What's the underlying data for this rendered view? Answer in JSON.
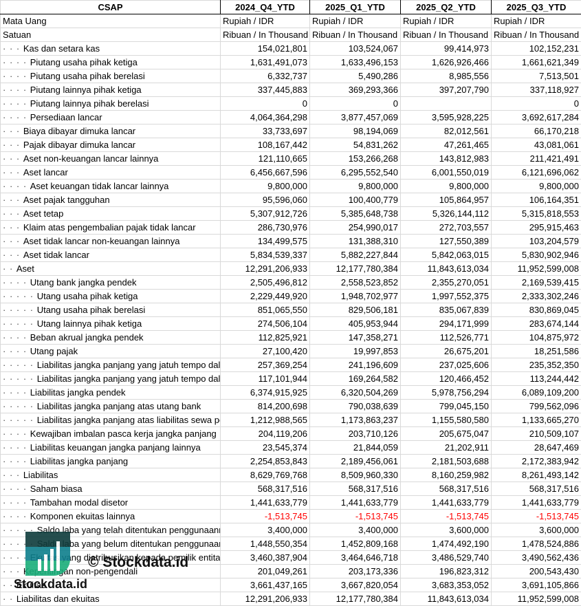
{
  "header": {
    "title": "CSAP",
    "columns": [
      "2024_Q4_YTD",
      "2025_Q1_YTD",
      "2025_Q2_YTD",
      "2025_Q3_YTD"
    ]
  },
  "meta_rows": [
    {
      "label": "Mata Uang",
      "values": [
        "Rupiah / IDR",
        "Rupiah / IDR",
        "Rupiah / IDR",
        "Rupiah / IDR"
      ]
    },
    {
      "label": "Satuan",
      "values": [
        "Ribuan / In Thousand",
        "Ribuan / In Thousand",
        "Ribuan / In Thousand",
        "Ribuan / In Thousand"
      ]
    }
  ],
  "rows": [
    {
      "level": 3,
      "label": "Kas dan setara kas",
      "values": [
        "154,021,801",
        "103,524,067",
        "99,414,973",
        "102,152,231"
      ]
    },
    {
      "level": 4,
      "label": "Piutang usaha pihak ketiga",
      "values": [
        "1,631,491,073",
        "1,633,496,153",
        "1,626,926,466",
        "1,661,621,349"
      ]
    },
    {
      "level": 4,
      "label": "Piutang usaha pihak berelasi",
      "values": [
        "6,332,737",
        "5,490,286",
        "8,985,556",
        "7,513,501"
      ]
    },
    {
      "level": 4,
      "label": "Piutang lainnya pihak ketiga",
      "values": [
        "337,445,883",
        "369,293,366",
        "397,207,790",
        "337,118,927"
      ]
    },
    {
      "level": 4,
      "label": "Piutang lainnya pihak berelasi",
      "values": [
        "0",
        "0",
        "",
        "0"
      ]
    },
    {
      "level": 4,
      "label": "Persediaan lancar",
      "values": [
        "4,064,364,298",
        "3,877,457,069",
        "3,595,928,225",
        "3,692,617,284"
      ]
    },
    {
      "level": 3,
      "label": "Biaya dibayar dimuka lancar",
      "values": [
        "33,733,697",
        "98,194,069",
        "82,012,561",
        "66,170,218"
      ]
    },
    {
      "level": 3,
      "label": "Pajak dibayar dimuka lancar",
      "values": [
        "108,167,442",
        "54,831,262",
        "47,261,465",
        "43,081,061"
      ]
    },
    {
      "level": 3,
      "label": "Aset non-keuangan lancar lainnya",
      "values": [
        "121,110,665",
        "153,266,268",
        "143,812,983",
        "211,421,491"
      ]
    },
    {
      "level": 3,
      "label": "Aset lancar",
      "values": [
        "6,456,667,596",
        "6,295,552,540",
        "6,001,550,019",
        "6,121,696,062"
      ]
    },
    {
      "level": 4,
      "label": "Aset keuangan tidak lancar lainnya",
      "values": [
        "9,800,000",
        "9,800,000",
        "9,800,000",
        "9,800,000"
      ]
    },
    {
      "level": 3,
      "label": "Aset pajak tangguhan",
      "values": [
        "95,596,060",
        "100,400,779",
        "105,864,957",
        "106,164,351"
      ]
    },
    {
      "level": 3,
      "label": "Aset tetap",
      "values": [
        "5,307,912,726",
        "5,385,648,738",
        "5,326,144,112",
        "5,315,818,553"
      ]
    },
    {
      "level": 3,
      "label": "Klaim atas pengembalian pajak tidak lancar",
      "values": [
        "286,730,976",
        "254,990,017",
        "272,703,557",
        "295,915,463"
      ]
    },
    {
      "level": 3,
      "label": "Aset tidak lancar non-keuangan lainnya",
      "values": [
        "134,499,575",
        "131,388,310",
        "127,550,389",
        "103,204,579"
      ]
    },
    {
      "level": 3,
      "label": "Aset tidak lancar",
      "values": [
        "5,834,539,337",
        "5,882,227,844",
        "5,842,063,015",
        "5,830,902,946"
      ]
    },
    {
      "level": 2,
      "label": "Aset",
      "values": [
        "12,291,206,933",
        "12,177,780,384",
        "11,843,613,034",
        "11,952,599,008"
      ]
    },
    {
      "level": 4,
      "label": "Utang bank jangka pendek",
      "values": [
        "2,505,496,812",
        "2,558,523,852",
        "2,355,270,051",
        "2,169,539,415"
      ]
    },
    {
      "level": 5,
      "label": "Utang usaha pihak ketiga",
      "values": [
        "2,229,449,920",
        "1,948,702,977",
        "1,997,552,375",
        "2,333,302,246"
      ]
    },
    {
      "level": 5,
      "label": "Utang usaha pihak berelasi",
      "values": [
        "851,065,550",
        "829,506,181",
        "835,067,839",
        "830,869,045"
      ]
    },
    {
      "level": 5,
      "label": "Utang lainnya pihak ketiga",
      "values": [
        "274,506,104",
        "405,953,944",
        "294,171,999",
        "283,674,144"
      ]
    },
    {
      "level": 4,
      "label": "Beban akrual jangka pendek",
      "values": [
        "112,825,921",
        "147,358,271",
        "112,526,771",
        "104,875,972"
      ]
    },
    {
      "level": 4,
      "label": "Utang pajak",
      "values": [
        "27,100,420",
        "19,997,853",
        "26,675,201",
        "18,251,586"
      ]
    },
    {
      "level": 5,
      "label": "Liabilitas jangka panjang yang jatuh tempo dalam satu tahun atas utang bank",
      "values": [
        "257,369,254",
        "241,196,609",
        "237,025,606",
        "235,352,350"
      ]
    },
    {
      "level": 5,
      "label": "Liabilitas jangka panjang yang jatuh tempo dalam satu tahun atas liabilitas sewa",
      "values": [
        "117,101,944",
        "169,264,582",
        "120,466,452",
        "113,244,442"
      ]
    },
    {
      "level": 4,
      "label": "Liabilitas jangka pendek",
      "values": [
        "6,374,915,925",
        "6,320,504,269",
        "5,978,756,294",
        "6,089,109,200"
      ]
    },
    {
      "level": 5,
      "label": "Liabilitas jangka panjang atas utang bank",
      "values": [
        "814,200,698",
        "790,038,639",
        "799,045,150",
        "799,562,096"
      ]
    },
    {
      "level": 5,
      "label": "Liabilitas jangka panjang atas liabilitas sewa pembiayaan",
      "values": [
        "1,212,988,565",
        "1,173,863,237",
        "1,155,580,580",
        "1,133,665,270"
      ]
    },
    {
      "level": 4,
      "label": "Kewajiban imbalan pasca kerja jangka panjang",
      "values": [
        "204,119,206",
        "203,710,126",
        "205,675,047",
        "210,509,107"
      ]
    },
    {
      "level": 4,
      "label": "Liabilitas keuangan jangka panjang lainnya",
      "values": [
        "23,545,374",
        "21,844,059",
        "21,202,911",
        "28,647,469"
      ]
    },
    {
      "level": 4,
      "label": "Liabilitas jangka panjang",
      "values": [
        "2,254,853,843",
        "2,189,456,061",
        "2,181,503,688",
        "2,172,383,942"
      ]
    },
    {
      "level": 3,
      "label": "Liabilitas",
      "values": [
        "8,629,769,768",
        "8,509,960,330",
        "8,160,259,982",
        "8,261,493,142"
      ]
    },
    {
      "level": 4,
      "label": "Saham biasa",
      "values": [
        "568,317,516",
        "568,317,516",
        "568,317,516",
        "568,317,516"
      ]
    },
    {
      "level": 4,
      "label": "Tambahan modal disetor",
      "values": [
        "1,441,633,779",
        "1,441,633,779",
        "1,441,633,779",
        "1,441,633,779"
      ]
    },
    {
      "level": 4,
      "label": "Komponen ekuitas lainnya",
      "values": [
        "-1,513,745",
        "-1,513,745",
        "-1,513,745",
        "-1,513,745"
      ]
    },
    {
      "level": 5,
      "label": "Saldo laba yang telah ditentukan penggunaannya",
      "values": [
        "3,400,000",
        "3,400,000",
        "3,600,000",
        "3,600,000"
      ]
    },
    {
      "level": 5,
      "label": "Saldo laba yang belum ditentukan penggunaannya",
      "values": [
        "1,448,550,354",
        "1,452,809,168",
        "1,474,492,190",
        "1,478,524,886"
      ]
    },
    {
      "level": 4,
      "label": "Ekuitas yang diatribusikan kepada pemilik entitas induk",
      "values": [
        "3,460,387,904",
        "3,464,646,718",
        "3,486,529,740",
        "3,490,562,436"
      ]
    },
    {
      "level": 3,
      "label": "Kepentingan non-pengendali",
      "values": [
        "201,049,261",
        "203,173,336",
        "196,823,312",
        "200,543,430"
      ]
    },
    {
      "level": 2,
      "label": "Ekuitas",
      "values": [
        "3,661,437,165",
        "3,667,820,054",
        "3,683,353,052",
        "3,691,105,866"
      ]
    },
    {
      "level": 2,
      "label": "Liabilitas dan ekuitas",
      "values": [
        "12,291,206,933",
        "12,177,780,384",
        "11,843,613,034",
        "11,952,599,008"
      ]
    }
  ],
  "colors": {
    "negative": "#ff0000",
    "grid": "#d9d9d9",
    "logo_dark": "#0e3b3b",
    "logo_teal": "#0e7f8c",
    "logo_green": "#1aae7a"
  },
  "watermark": {
    "text_main": "© Stockdata.id",
    "text_logo": "Stockdata.id"
  }
}
